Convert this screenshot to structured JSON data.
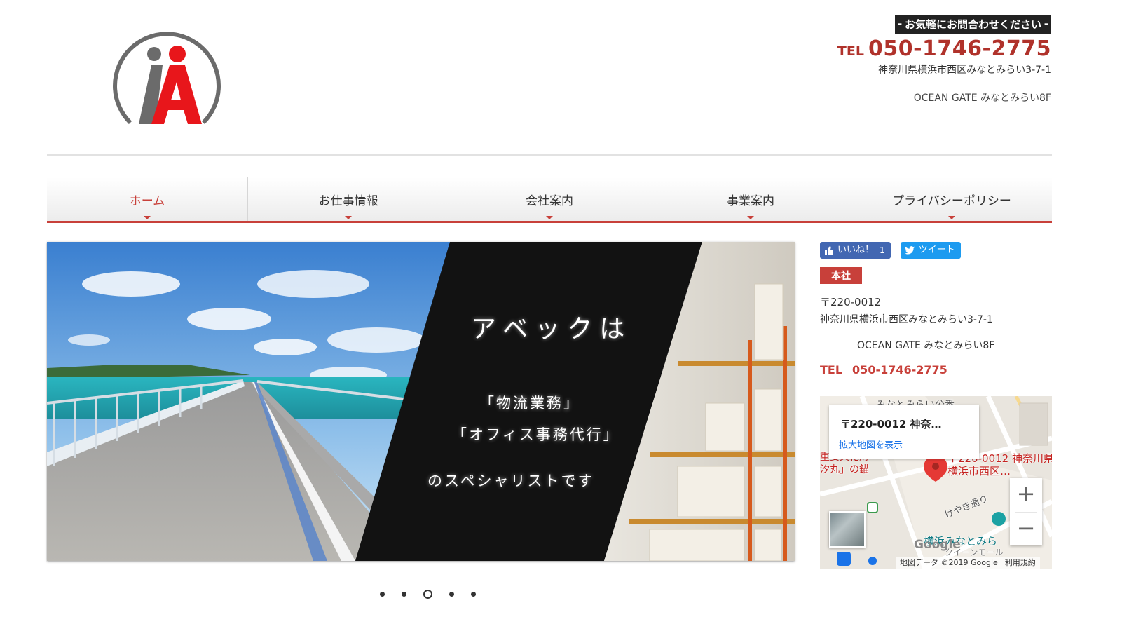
{
  "header": {
    "contact_banner": "お気軽にお問合わせください",
    "tel_prefix": "TEL",
    "tel_number": "050-1746-2775",
    "address_line1": "神奈川県横浜市西区みなとみらい3-7-1",
    "address_line2": "OCEAN GATE みなとみらい8F"
  },
  "nav": {
    "items": [
      {
        "label": "ホーム",
        "active": true
      },
      {
        "label": "お仕事情報"
      },
      {
        "label": "会社案内"
      },
      {
        "label": "事業案内"
      },
      {
        "label": "プライバシーポリシー"
      }
    ]
  },
  "hero": {
    "title": "アベックは",
    "line1": "「物流業務」",
    "line2": "「オフィス事務代行」",
    "line3": "のスペシャリストです",
    "slide_count": 5,
    "current_slide": 3
  },
  "sidebar": {
    "like_label": "いいね！",
    "like_count": "1",
    "tweet_label": "ツイート",
    "badge": "本社",
    "postal": "〒220-0012",
    "address_line1": "神奈川県横浜市西区みなとみらい3-7-1",
    "address_line2": "OCEAN GATE みなとみらい8F",
    "tel_label": "TEL",
    "tel_number": "050-1746-2775"
  },
  "map": {
    "card_title": "〒220-0012 神奈…",
    "card_link": "拡大地図を表示",
    "pin_label_1": "〒220-0012 神奈川県",
    "pin_label_2": "横浜市西区…",
    "label_top": "みなとみらい公番",
    "label_left_1": "重要文化財",
    "label_left_2": "汐丸」の錨",
    "label_street": "けやき通り",
    "label_bottom": "横浜みなとみら",
    "label_bottom2": "クイーンモール",
    "footer_data": "地図データ ©2019 Google",
    "footer_terms": "利用規約",
    "google": "Google",
    "zoom_in": "+",
    "zoom_out": "−"
  },
  "colors": {
    "accent": "#c8403a",
    "logo_red": "#e8161b",
    "logo_gray": "#6b6b6b",
    "facebook": "#4267b2",
    "twitter": "#1d9bf0"
  }
}
